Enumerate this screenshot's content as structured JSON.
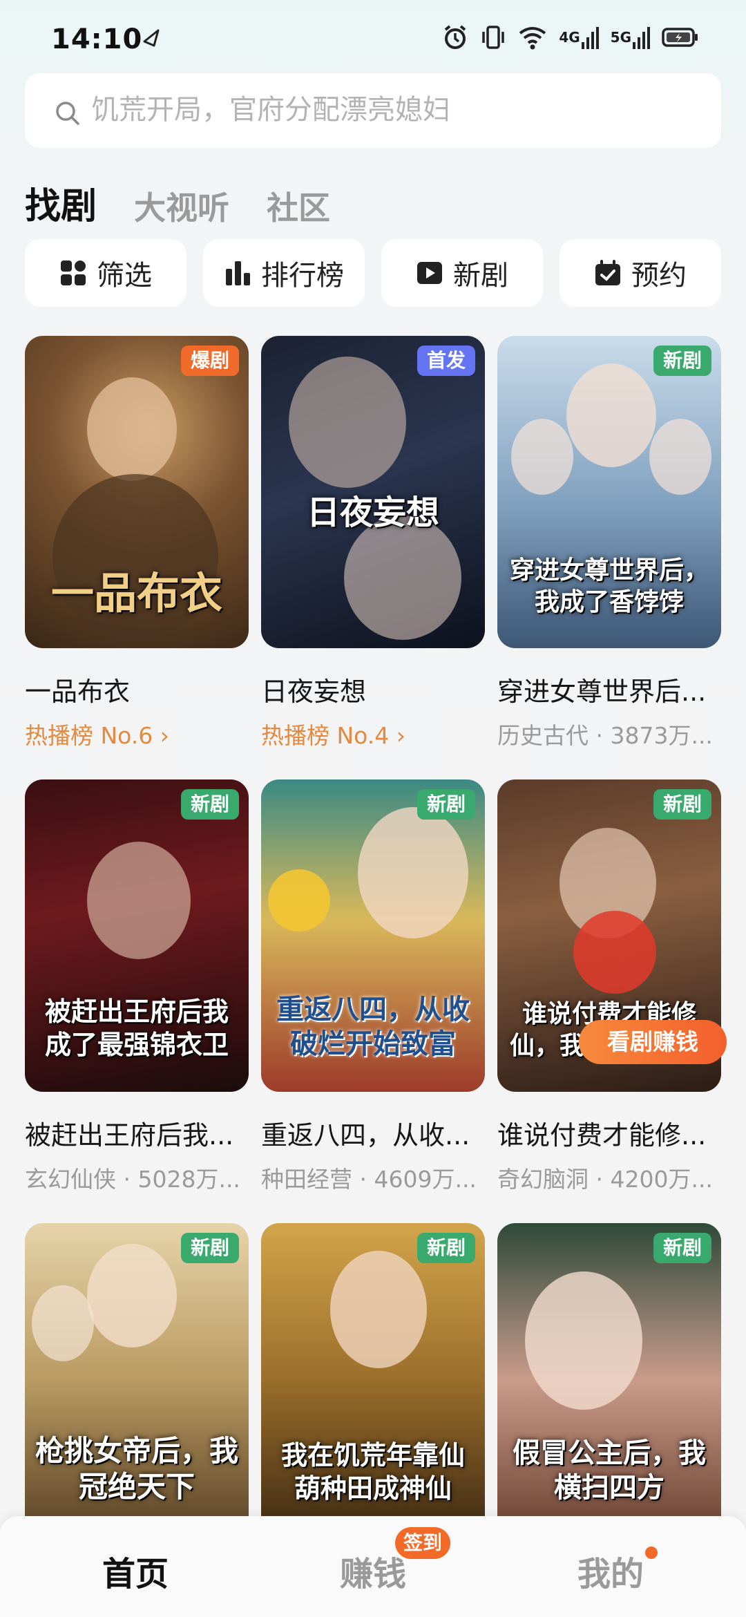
{
  "status_bar": {
    "time": "14:10",
    "net_4g": "4G",
    "net_5g": "5G"
  },
  "search": {
    "placeholder": "饥荒开局，官府分配漂亮媳妇"
  },
  "tabs": [
    {
      "label": "找剧",
      "active": true
    },
    {
      "label": "大视听",
      "active": false
    },
    {
      "label": "社区",
      "active": false
    }
  ],
  "quick_actions": [
    {
      "label": "筛选",
      "icon": "grid-filter-icon"
    },
    {
      "label": "排行榜",
      "icon": "bar-chart-icon"
    },
    {
      "label": "新剧",
      "icon": "play-icon"
    },
    {
      "label": "预约",
      "icon": "calendar-check-icon"
    }
  ],
  "dramas": [
    {
      "title": "一品布衣",
      "subtitle": "热播榜 No.6 ›",
      "badge": "爆剧",
      "art_text": "一品布衣"
    },
    {
      "title": "日夜妄想",
      "subtitle": "热播榜 No.4 ›",
      "badge": "首发",
      "art_text": "日夜妄想"
    },
    {
      "title": "穿进女尊世界后...",
      "subtitle": "历史古代 · 3873万...",
      "badge": "新剧",
      "art_text": "穿进女尊世界后，我成了香饽饽"
    },
    {
      "title": "被赶出王府后我...",
      "subtitle": "玄幻仙侠 · 5028万...",
      "badge": "新剧",
      "art_text": "被赶出王府后我成了最强锦衣卫"
    },
    {
      "title": "重返八四，从收...",
      "subtitle": "种田经营 · 4609万...",
      "badge": "新剧",
      "art_text": "重返八四，从收破烂开始致富"
    },
    {
      "title": "谁说付费才能修...",
      "subtitle": "奇幻脑洞 · 4200万...",
      "badge": "新剧",
      "art_text": "谁说付费才能修仙，我的系统免费"
    },
    {
      "title": "",
      "subtitle": "",
      "badge": "新剧",
      "art_text": "枪挑女帝后，我冠绝天下"
    },
    {
      "title": "",
      "subtitle": "",
      "badge": "新剧",
      "art_text": "我在饥荒年靠仙葫种田成神仙"
    },
    {
      "title": "",
      "subtitle": "",
      "badge": "新剧",
      "art_text": "假冒公主后，我横扫四方"
    }
  ],
  "earn_button": "看剧赚钱",
  "bottom_nav": [
    {
      "label": "首页",
      "active": true
    },
    {
      "label": "赚钱",
      "active": false,
      "badge": "签到"
    },
    {
      "label": "我的",
      "active": false
    }
  ],
  "colors": {
    "accent": "#f26a28",
    "rank_text": "#e48a3f",
    "badge_new": "#3aa96e",
    "badge_first": "#6574f2"
  }
}
